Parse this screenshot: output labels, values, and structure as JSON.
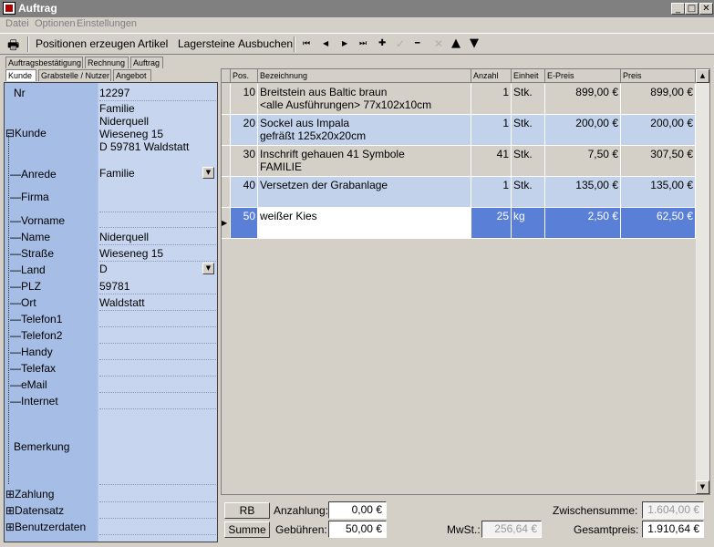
{
  "window": {
    "title": "Auftrag",
    "min_btn": "_",
    "max_btn": "□",
    "close_btn": "✕"
  },
  "menu": [
    "Datei",
    "Optionen",
    "Einstellungen"
  ],
  "toolbar": {
    "print_icon": "🖶",
    "buttons": [
      "Positionen erzeugen",
      "Artikel",
      "Lagersteine",
      "Ausbuchen"
    ],
    "nav_icons": {
      "first": "⏮",
      "prev": "◀",
      "next": "▶",
      "last": "⏭",
      "add": "✚",
      "post": "✓",
      "delete": "━",
      "cancel": "✕",
      "up": "▲",
      "down": "▼"
    }
  },
  "tabs": {
    "row1": [
      "Auftragsbestätigung",
      "Rechnung",
      "Auftrag"
    ],
    "row2": [
      "Kunde",
      "Grabstelle / Nutzer",
      "Angebot"
    ]
  },
  "customer": {
    "nr_label": "Nr",
    "nr": "12297",
    "kunde_label": "⊟Kunde",
    "kunde": "Familie\n Niderquell\nWieseneg 15\nD 59781 Waldstatt",
    "fields": [
      {
        "label": "—Anrede",
        "value": "Familie",
        "combo": true
      },
      {
        "label": "—Firma",
        "value": ""
      },
      {
        "label": "—Vorname",
        "value": ""
      },
      {
        "label": "—Name",
        "value": "Niderquell"
      },
      {
        "label": "—Straße",
        "value": "Wieseneg 15"
      },
      {
        "label": "—Land",
        "value": "D",
        "combo": true
      },
      {
        "label": "—PLZ",
        "value": "59781"
      },
      {
        "label": "—Ort",
        "value": "Waldstatt"
      },
      {
        "label": "—Telefon1",
        "value": ""
      },
      {
        "label": "—Telefon2",
        "value": ""
      },
      {
        "label": "—Handy",
        "value": ""
      },
      {
        "label": "—Telefax",
        "value": ""
      },
      {
        "label": "—eMail",
        "value": ""
      },
      {
        "label": "—Internet",
        "value": ""
      }
    ],
    "bemerkung_label": "Bemerkung",
    "groups": [
      "⊞Zahlung",
      "⊞Datensatz",
      "⊞Benutzerdaten"
    ]
  },
  "grid": {
    "headers": [
      "Pos.",
      "Bezeichnung",
      "Anzahl",
      "Einheit",
      "E-Preis",
      "Preis"
    ],
    "rows": [
      {
        "pos": "10",
        "bez": "Breitstein aus Baltic braun\n<alle Ausführungen> 77x102x10cm",
        "anz": "1",
        "einh": "Stk.",
        "epreis": "899,00 €",
        "preis": "899,00 €"
      },
      {
        "pos": "20",
        "bez": "Sockel aus Impala\ngefräßt 125x20x20cm",
        "anz": "1",
        "einh": "Stk.",
        "epreis": "200,00 €",
        "preis": "200,00 €"
      },
      {
        "pos": "30",
        "bez": "Inschrift gehauen 41 Symbole\nFAMILIE",
        "anz": "41",
        "einh": "Stk.",
        "epreis": "7,50 €",
        "preis": "307,50 €"
      },
      {
        "pos": "40",
        "bez": "Versetzen der Grabanlage",
        "anz": "1",
        "einh": "Stk.",
        "epreis": "135,00 €",
        "preis": "135,00 €"
      },
      {
        "pos": "50",
        "bez": "weißer Kies",
        "anz": "25",
        "einh": "kg",
        "epreis": "2,50 €",
        "preis": "62,50 €"
      }
    ],
    "row_colors": [
      "#d4d0c8",
      "#c2d2ea",
      "#d4d0c8",
      "#c2d2ea",
      "#5a7fd6"
    ],
    "current_marker": "▶"
  },
  "bottom": {
    "rb": "RB",
    "summe": "Summe",
    "anzahlung_label": "Anzahlung:",
    "anzahlung": "0,00 €",
    "gebuehren_label": "Gebühren:",
    "gebuehren": "50,00 €",
    "mwst_label": "MwSt.:",
    "mwst": "256,64 €",
    "zwischensumme_label": "Zwischensumme:",
    "zwischensumme": "1.604,00 €",
    "gesamtpreis_label": "Gesamtpreis:",
    "gesamtpreis": "1.910,64 €"
  }
}
